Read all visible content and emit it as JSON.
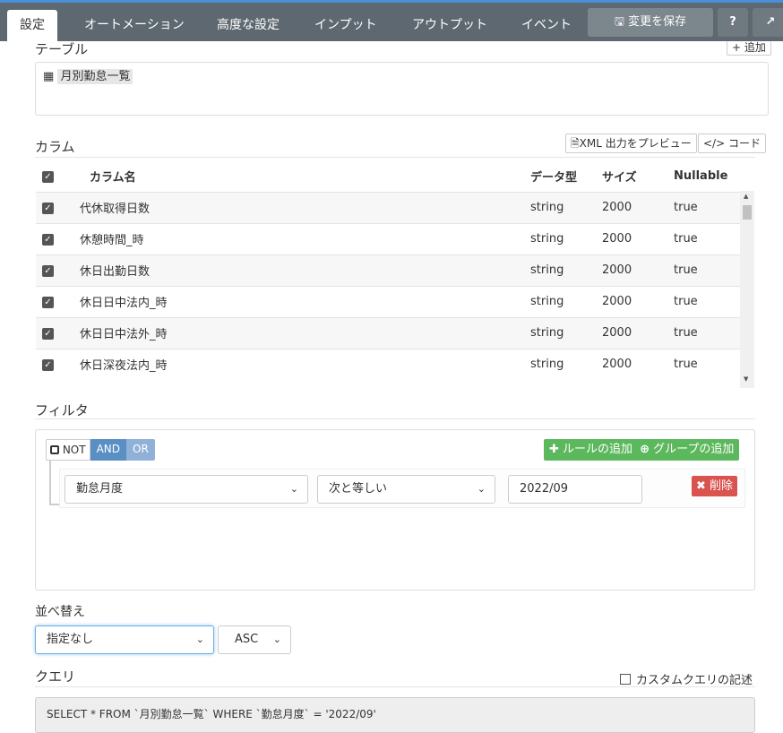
{
  "tabs": [
    "設定",
    "オートメーション",
    "高度な設定",
    "インプット",
    "アウトプット",
    "イベント"
  ],
  "toolbar": {
    "save_label": "変更を保存",
    "help_label": "?",
    "external_label": "↗"
  },
  "table_section": {
    "title": "テーブル",
    "add_label": "+ 追加",
    "table_name": "月別勤怠一覧"
  },
  "columns_section": {
    "title": "カラム",
    "xml_preview_label": "XML 出力をプレビュー",
    "code_label": "</> コード",
    "headers": [
      "カラム名",
      "データ型",
      "サイズ",
      "Nullable"
    ],
    "rows": [
      {
        "name": "代休取得日数",
        "type": "string",
        "size": "2000",
        "nullable": "true"
      },
      {
        "name": "休憩時間_時",
        "type": "string",
        "size": "2000",
        "nullable": "true"
      },
      {
        "name": "休日出勤日数",
        "type": "string",
        "size": "2000",
        "nullable": "true"
      },
      {
        "name": "休日日中法内_時",
        "type": "string",
        "size": "2000",
        "nullable": "true"
      },
      {
        "name": "休日日中法外_時",
        "type": "string",
        "size": "2000",
        "nullable": "true"
      },
      {
        "name": "休日深夜法内_時",
        "type": "string",
        "size": "2000",
        "nullable": "true"
      }
    ]
  },
  "filter_section": {
    "title": "フィルタ",
    "not_label": "NOT",
    "and_label": "AND",
    "or_label": "OR",
    "add_rule_label": "ルールの追加",
    "add_group_label": "グループの追加",
    "rule": {
      "field": "勤怠月度",
      "operator": "次と等しい",
      "value": "2022/09",
      "delete_label": "削除"
    }
  },
  "sort_section": {
    "title": "並べ替え",
    "field": "指定なし",
    "order": "ASC"
  },
  "query_section": {
    "title": "クエリ",
    "custom_label": "カスタムクエリの記述",
    "query": "SELECT * FROM `月別勤怠一覧` WHERE `勤怠月度` = '2022/09'"
  }
}
